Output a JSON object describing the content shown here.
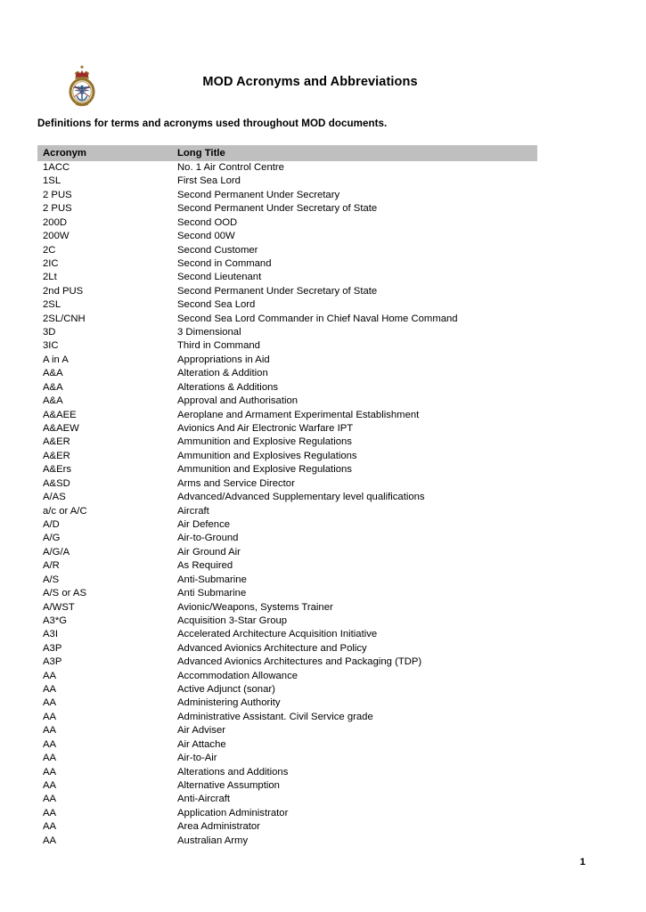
{
  "document": {
    "title": "MOD Acronyms and Abbreviations",
    "subtitle": "Definitions for terms and acronyms used throughout MOD documents.",
    "page_number": "1",
    "crest_name": "mod-crest-icon",
    "colors": {
      "header_row_background": "#bfbfbf",
      "text": "#000000",
      "page_background": "#ffffff",
      "crest_gold": "#9c7a33",
      "crest_red": "#9e2a2b",
      "crest_blue": "#2e5c8a"
    }
  },
  "table": {
    "columns": [
      "Acronym",
      "Long Title"
    ],
    "rows": [
      [
        "1ACC",
        "No. 1 Air Control Centre"
      ],
      [
        "1SL",
        "First Sea Lord"
      ],
      [
        "2 PUS",
        "Second Permanent Under Secretary"
      ],
      [
        "2 PUS",
        "Second Permanent Under Secretary of State"
      ],
      [
        "200D",
        "Second OOD"
      ],
      [
        "200W",
        "Second 00W"
      ],
      [
        "2C",
        "Second Customer"
      ],
      [
        "2IC",
        "Second in Command"
      ],
      [
        "2Lt",
        "Second Lieutenant"
      ],
      [
        "2nd PUS",
        "Second Permanent Under Secretary of State"
      ],
      [
        "2SL",
        "Second Sea Lord"
      ],
      [
        "2SL/CNH",
        "Second Sea Lord Commander in Chief Naval Home Command"
      ],
      [
        "3D",
        "3 Dimensional"
      ],
      [
        "3IC",
        "Third in Command"
      ],
      [
        "A in A",
        "Appropriations in Aid"
      ],
      [
        "A&A",
        "Alteration & Addition"
      ],
      [
        "A&A",
        "Alterations & Additions"
      ],
      [
        "A&A",
        "Approval and Authorisation"
      ],
      [
        "A&AEE",
        "Aeroplane and Armament Experimental Establishment"
      ],
      [
        "A&AEW",
        "Avionics And Air Electronic Warfare IPT"
      ],
      [
        "A&ER",
        "Ammunition and Explosive Regulations"
      ],
      [
        "A&ER",
        "Ammunition and Explosives Regulations"
      ],
      [
        "A&Ers",
        "Ammunition and Explosive Regulations"
      ],
      [
        "A&SD",
        "Arms and Service Director"
      ],
      [
        "A/AS",
        "Advanced/Advanced Supplementary level qualifications"
      ],
      [
        "a/c or A/C",
        "Aircraft"
      ],
      [
        "A/D",
        "Air Defence"
      ],
      [
        "A/G",
        "Air-to-Ground"
      ],
      [
        "A/G/A",
        "Air Ground Air"
      ],
      [
        "A/R",
        "As Required"
      ],
      [
        "A/S",
        "Anti-Submarine"
      ],
      [
        "A/S or AS",
        "Anti Submarine"
      ],
      [
        "A/WST",
        "Avionic/Weapons, Systems Trainer"
      ],
      [
        "A3*G",
        "Acquisition 3-Star Group"
      ],
      [
        "A3I",
        "Accelerated Architecture Acquisition Initiative"
      ],
      [
        "A3P",
        "Advanced Avionics Architecture and Policy"
      ],
      [
        "A3P",
        "Advanced Avionics Architectures and Packaging (TDP)"
      ],
      [
        "AA",
        "Accommodation Allowance"
      ],
      [
        "AA",
        "Active Adjunct (sonar)"
      ],
      [
        "AA",
        "Administering Authority"
      ],
      [
        "AA",
        "Administrative Assistant. Civil Service grade"
      ],
      [
        "AA",
        "Air Adviser"
      ],
      [
        "AA",
        "Air Attache"
      ],
      [
        "AA",
        "Air-to-Air"
      ],
      [
        "AA",
        "Alterations and Additions"
      ],
      [
        "AA",
        "Alternative Assumption"
      ],
      [
        "AA",
        "Anti-Aircraft"
      ],
      [
        "AA",
        "Application Administrator"
      ],
      [
        "AA",
        "Area Administrator"
      ],
      [
        "AA",
        "Australian Army"
      ]
    ]
  }
}
